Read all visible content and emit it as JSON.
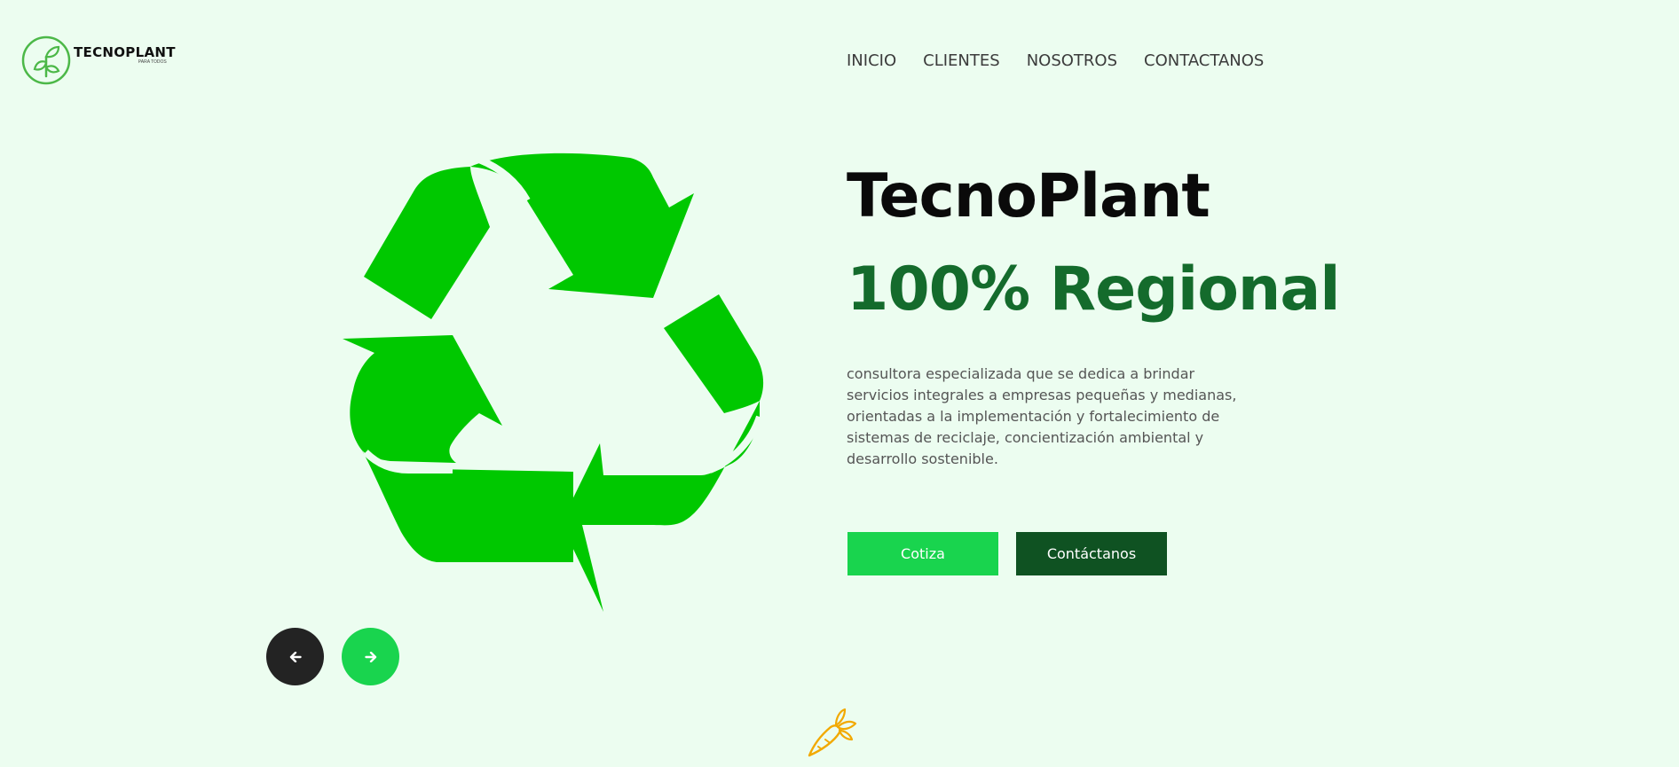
{
  "brand": {
    "name": "TECNOPLANT",
    "tagline": "PARA TODOS",
    "logo_icon": "leaf-circle-icon"
  },
  "nav": {
    "items": [
      {
        "label": "INICIO"
      },
      {
        "label": "CLIENTES"
      },
      {
        "label": "NOSOTROS"
      },
      {
        "label": "CONTACTANOS"
      }
    ]
  },
  "hero": {
    "graphic_icon": "recycle-icon",
    "title": "TecnoPlant",
    "subtitle": "100% Regional",
    "description": "consultora especializada que se dedica a brindar servicios integrales a empresas pequeñas y medianas, orientadas a la implementación y fortalecimiento de sistemas de reciclaje, concientización ambiental y desarrollo sostenible.",
    "primary_button": "Cotiza",
    "secondary_button": "Contáctanos"
  },
  "slider": {
    "prev_icon": "arrow-left-icon",
    "next_icon": "arrow-right-icon"
  },
  "decor": {
    "carrot_icon": "carrot-icon"
  },
  "colors": {
    "background": "#ecfdf0",
    "recycle_green": "#00c800",
    "accent_green": "#19d44e",
    "dark_green": "#0f5222",
    "subtitle_green": "#146b2c",
    "carrot_orange": "#f2a900",
    "dark": "#232323"
  }
}
